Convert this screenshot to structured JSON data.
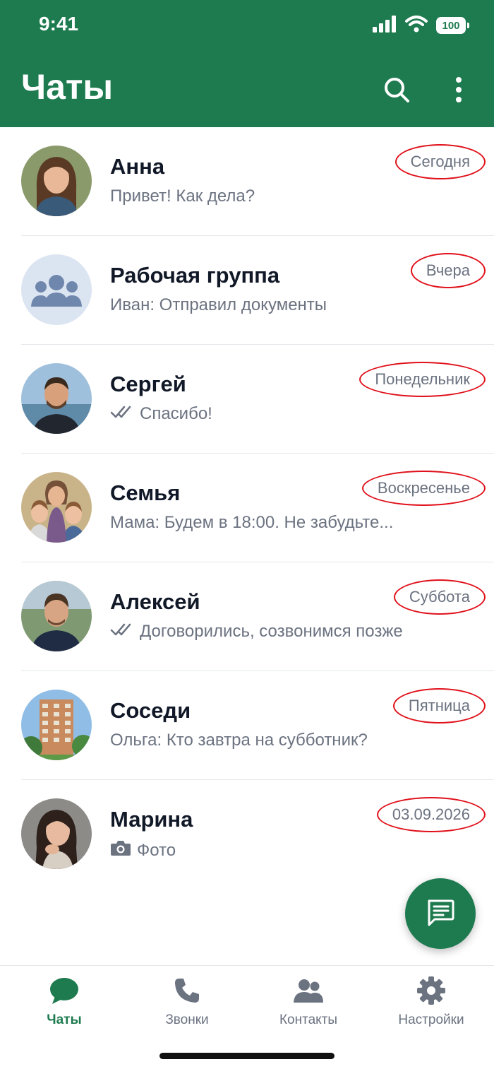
{
  "status_bar": {
    "time": "9:41",
    "battery": "100"
  },
  "header": {
    "title": "Чаты",
    "search_icon": "search-icon",
    "menu_icon": "more-vertical-icon",
    "color": "#1e7b4f"
  },
  "chats": [
    {
      "name": "Анна",
      "preview": "Привет! Как дела?",
      "time": "Сегодня",
      "indicator": "none",
      "avatar": "photo-woman"
    },
    {
      "name": "Рабочая группа",
      "preview": "Иван: Отправил документы",
      "time": "Вчера",
      "indicator": "none",
      "avatar": "group-icon"
    },
    {
      "name": "Сергей",
      "preview": "Спасибо!",
      "time": "Понедельник",
      "indicator": "double-check",
      "avatar": "photo-man"
    },
    {
      "name": "Семья",
      "preview": "Мама: Будем в 18:00. Не забудьте...",
      "time": "Воскресенье",
      "indicator": "none",
      "avatar": "photo-family"
    },
    {
      "name": "Алексей",
      "preview": "Договорились, созвонимся позже",
      "time": "Суббота",
      "indicator": "double-check",
      "avatar": "photo-man"
    },
    {
      "name": "Соседи",
      "preview": "Ольга: Кто завтра на субботник?",
      "time": "Пятница",
      "indicator": "none",
      "avatar": "photo-building"
    },
    {
      "name": "Марина",
      "preview": "Фото",
      "time": "03.09.2026",
      "indicator": "camera",
      "avatar": "photo-woman"
    }
  ],
  "fab": {
    "icon": "new-message-icon"
  },
  "bottom_nav": [
    {
      "label": "Чаты",
      "icon": "chat-bubble-icon",
      "active": true
    },
    {
      "label": "Звонки",
      "icon": "phone-icon",
      "active": false
    },
    {
      "label": "Контакты",
      "icon": "contacts-icon",
      "active": false
    },
    {
      "label": "Настройки",
      "icon": "settings-gear-icon",
      "active": false
    }
  ]
}
